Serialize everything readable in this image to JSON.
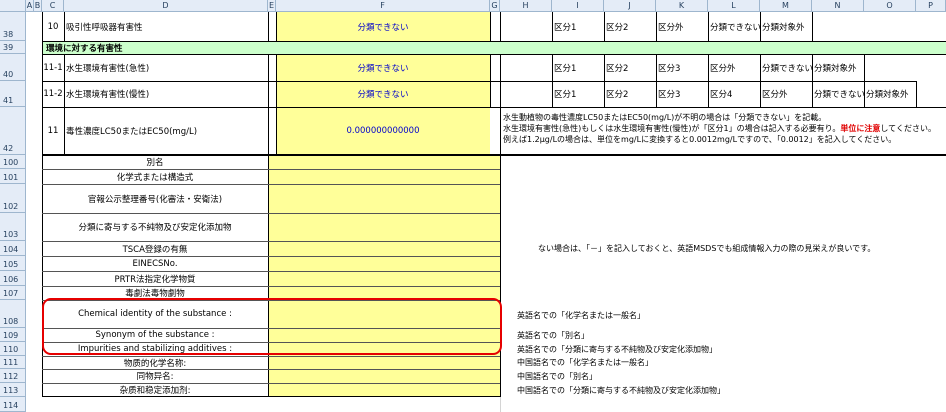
{
  "columns": [
    "A",
    "B",
    "C",
    "D",
    "E",
    "F",
    "G",
    "H",
    "I",
    "J",
    "K",
    "L",
    "M",
    "N",
    "O",
    "P"
  ],
  "rows": {
    "r38": {
      "num": "38",
      "no": "10",
      "label": "吸引性呼吸器有害性",
      "value": "分類できない",
      "opts": [
        "区分1",
        "区分2",
        "区分外",
        "分類できない",
        "分類対象外"
      ]
    },
    "r39": {
      "num": "39",
      "label": "環境に対する有害性"
    },
    "r40": {
      "num": "40",
      "no": "11-1",
      "label": "水生環境有害性(急性)",
      "value": "分類できない",
      "opts": [
        "区分1",
        "区分2",
        "区分3",
        "区分外",
        "分類できない",
        "分類対象外"
      ]
    },
    "r41": {
      "num": "41",
      "no": "11-2",
      "label": "水生環境有害性(慢性)",
      "value": "分類できない",
      "opts": [
        "区分1",
        "区分2",
        "区分3",
        "区分4",
        "区分外",
        "分類できない",
        "分類対象外"
      ]
    },
    "r42": {
      "num": "42",
      "no": "11",
      "label": "毒性濃度LC50またはEC50(mg/L)",
      "value": "0.000000000000",
      "note1": "水生動植物の毒性濃度LC50またはEC50(mg/L)が不明の場合は「分類できない」を記載。",
      "note2a": "水生環境有害性(急性)もしくは水生環境有害性(慢性)が「区分1」の場合は記入する必要有り。",
      "note2b": "単位に注意",
      "note2c": "してください。",
      "note3": "例えば1.2μg/Lの場合は、単位をmg/Lに変換すると0.0012mg/Lですので、「0.0012」を記入してください。"
    }
  },
  "lower_rows": [
    {
      "num": "100",
      "label": "別名"
    },
    {
      "num": "101",
      "label": "化学式または構造式"
    },
    {
      "num": "102",
      "label": "官報公示整理番号(化審法・安衛法)"
    },
    {
      "num": "103",
      "label": "分類に寄与する不純物及び安定化添加物"
    },
    {
      "num": "104",
      "label": "TSCA登録の有無"
    },
    {
      "num": "105",
      "label": "EINECSNo."
    },
    {
      "num": "106",
      "label": "PRTR法指定化学物質"
    },
    {
      "num": "107",
      "label": "毒劇法毒物劇物"
    },
    {
      "num": "108",
      "label": "Chemical identity of the substance :"
    },
    {
      "num": "109",
      "label": "Synonym of the substance :"
    },
    {
      "num": "110",
      "label": "Impurities and stabilizing additives :"
    },
    {
      "num": "111",
      "label": "物质的化学名称:"
    },
    {
      "num": "112",
      "label": "同物异名:"
    },
    {
      "num": "113",
      "label": "杂质和稳定添加剂:"
    },
    {
      "num": "114",
      "label": ""
    }
  ],
  "notes": {
    "n104": "ない場合は、「－」を記入しておくと、英語MSDSでも組成情報入力の際の見栄えが良いです。",
    "n108": "英語名での「化学名または一般名」",
    "n109": "英語名での「別名」",
    "n110": "英語名での「分類に寄与する不純物及び安定化添加物」",
    "n111": "中国語名での「化学名または一般名」",
    "n112": "中国語名での「別名」",
    "n113": "中国語名での「分類に寄与する不純物及び安定化添加物」"
  },
  "colors": {
    "input_fill": "#ffff99",
    "section_fill": "#ccffcc",
    "highlight": "#e60000",
    "header_fill": "#e4ecf7"
  }
}
